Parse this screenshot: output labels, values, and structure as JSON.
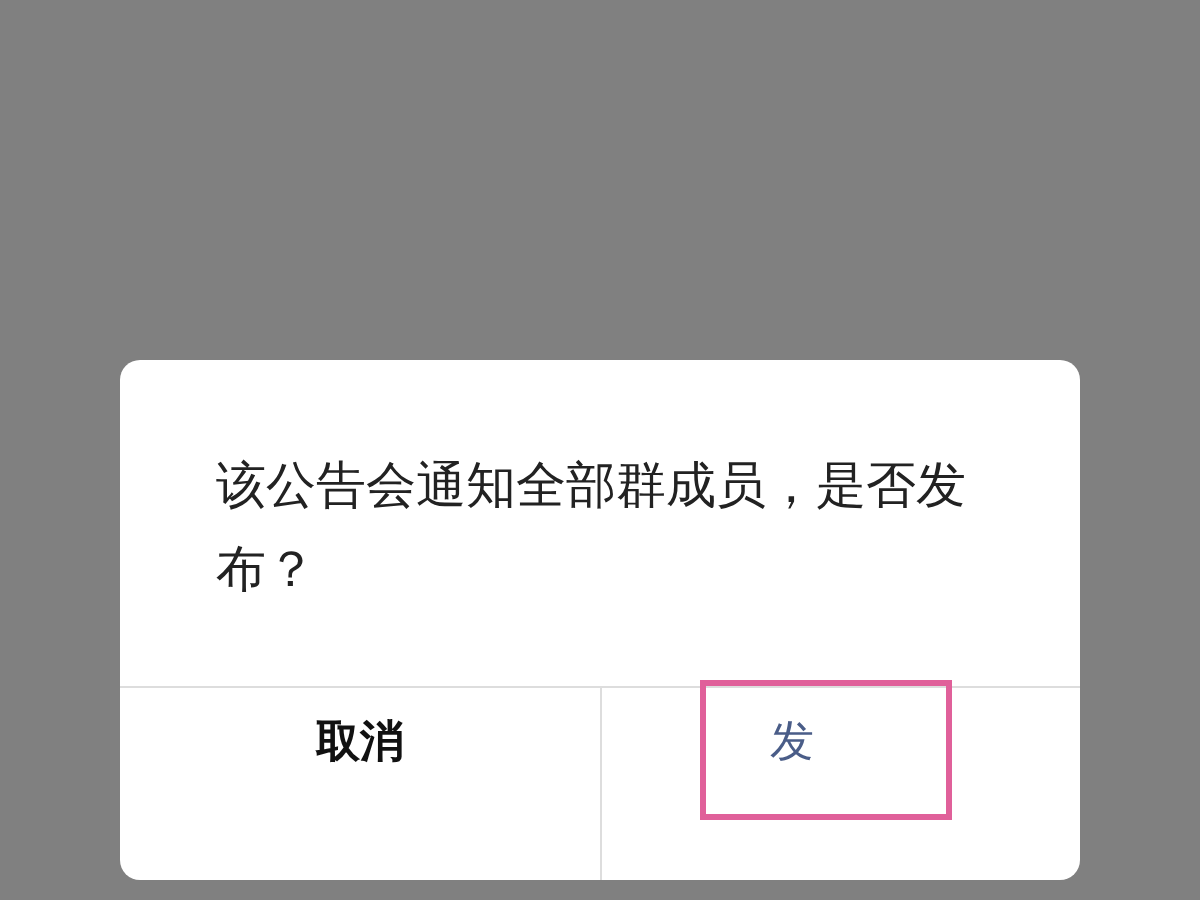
{
  "dialog": {
    "message": "该公告会通知全部群成员，是否发布？",
    "buttons": [
      {
        "label": "取消",
        "kind": "cancel",
        "highlighted": false
      },
      {
        "label": "发",
        "kind": "confirm",
        "highlighted": true
      }
    ]
  }
}
